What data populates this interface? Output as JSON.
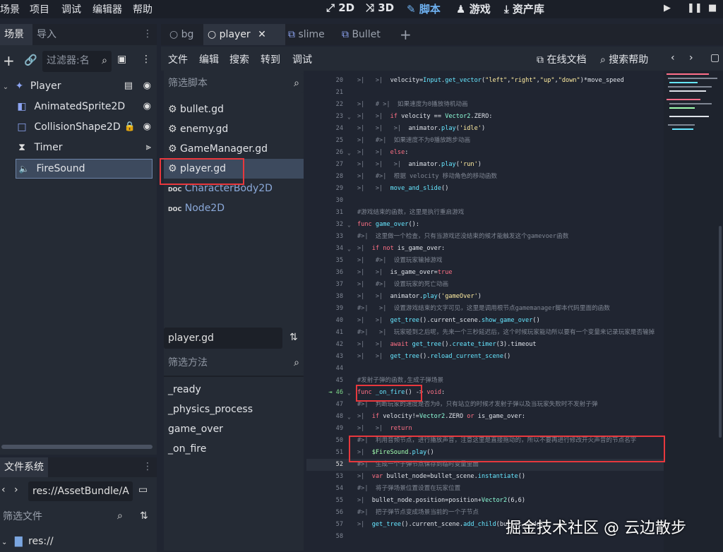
{
  "menu": [
    "场景",
    "项目",
    "调试",
    "编辑器",
    "帮助"
  ],
  "modes": [
    {
      "icon": "⤢",
      "label": "2D"
    },
    {
      "icon": "⤨",
      "label": "3D"
    },
    {
      "icon": "✎",
      "label": "脚本"
    },
    {
      "icon": "♟",
      "label": "游戏"
    },
    {
      "icon": "⤓",
      "label": "资产库"
    }
  ],
  "scene_panel": {
    "tabs": [
      "场景",
      "导入"
    ],
    "filter_placeholder": "过滤器:名",
    "nodes": [
      {
        "icon": "✦",
        "label": "Player"
      },
      {
        "icon": "◧",
        "label": "AnimatedSprite2D"
      },
      {
        "icon": "□",
        "label": "CollisionShape2D"
      },
      {
        "icon": "⧗",
        "label": "Timer"
      },
      {
        "icon": "🔈",
        "label": "FireSound"
      }
    ]
  },
  "filesystem": {
    "title": "文件系统",
    "path": "res://AssetBundle/A",
    "filter_placeholder": "筛选文件",
    "root": "res://"
  },
  "editor_tabs": [
    {
      "icon": "○",
      "label": "bg"
    },
    {
      "icon": "○",
      "label": "player",
      "close": "✕"
    },
    {
      "icon": "⧉",
      "label": "slime"
    },
    {
      "icon": "⧉",
      "label": "Bullet"
    },
    {
      "icon": "+",
      "label": ""
    }
  ],
  "toolbar": {
    "file": "文件",
    "edit": "编辑",
    "search": "搜索",
    "goto": "转到",
    "debug": "调试",
    "online_docs": "在线文档",
    "search_help": "搜索帮助"
  },
  "script_list": {
    "filter_placeholder": "筛选脚本",
    "scripts": [
      {
        "icon": "⚙",
        "label": "bullet.gd"
      },
      {
        "icon": "⚙",
        "label": "enemy.gd"
      },
      {
        "icon": "⚙",
        "label": "GameManager.gd"
      },
      {
        "icon": "⚙",
        "label": "player.gd"
      },
      {
        "icon": "DOC",
        "label": "CharacterBody2D"
      },
      {
        "icon": "DOC",
        "label": "Node2D"
      }
    ],
    "current_script": "player.gd",
    "method_filter_placeholder": "筛选方法",
    "methods": [
      "_ready",
      "_physics_process",
      "game_over",
      "_on_fire"
    ]
  },
  "watermark": "掘金技术社区 @ 云边散步"
}
